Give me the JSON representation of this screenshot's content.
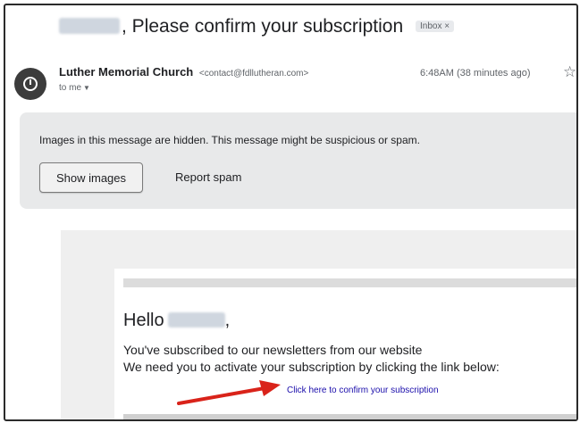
{
  "email": {
    "subject": ", Please confirm your subscription",
    "label_badge": "Inbox",
    "label_close": "×",
    "sender_name": "Luther Memorial Church",
    "sender_email": "<contact@fdllutheran.com>",
    "recipient": "to me",
    "time": "6:48AM (38 minutes ago)"
  },
  "warning": {
    "message": "Images in this message are hidden. This message might be suspicious or spam.",
    "show_images_label": "Show images",
    "report_spam_label": "Report spam"
  },
  "body": {
    "greeting": "Hello",
    "greeting_suffix": ",",
    "line1": "You've subscribed to our newsletters from our website",
    "line2": "We need you to activate your subscription by clicking the link below:",
    "link_text": "Click here to confirm your subscription"
  },
  "colors": {
    "arrow": "#d9231a",
    "link": "#1a0dab"
  }
}
